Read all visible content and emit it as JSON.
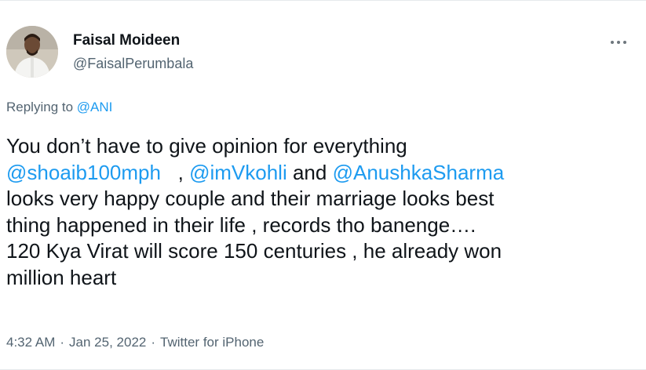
{
  "author": {
    "name": "Faisal Moideen",
    "handle": "@FaisalPerumbala"
  },
  "reply": {
    "prefix": "Replying to",
    "target": "@ANI"
  },
  "body": {
    "line1": "You don’t have to give opinion for everything",
    "mention1": "@shoaib100mph",
    "between1": "   , ",
    "mention2": "@imVkohli",
    "between2": " and ",
    "mention3": "@AnushkaSharma",
    "line3": "looks very happy couple and their marriage looks best",
    "line4": "thing happened in their life , records tho banenge….",
    "line5": "120 Kya Virat will score 150 centuries , he already won",
    "line6": "million heart"
  },
  "meta": {
    "time": "4:32 AM",
    "date": "Jan 25, 2022",
    "source": "Twitter for iPhone",
    "separator": "·"
  },
  "icons": {
    "more": "more-horizontal-icon"
  },
  "colors": {
    "link": "#1d9bf0",
    "secondary": "#536471",
    "text": "#0f1419"
  }
}
